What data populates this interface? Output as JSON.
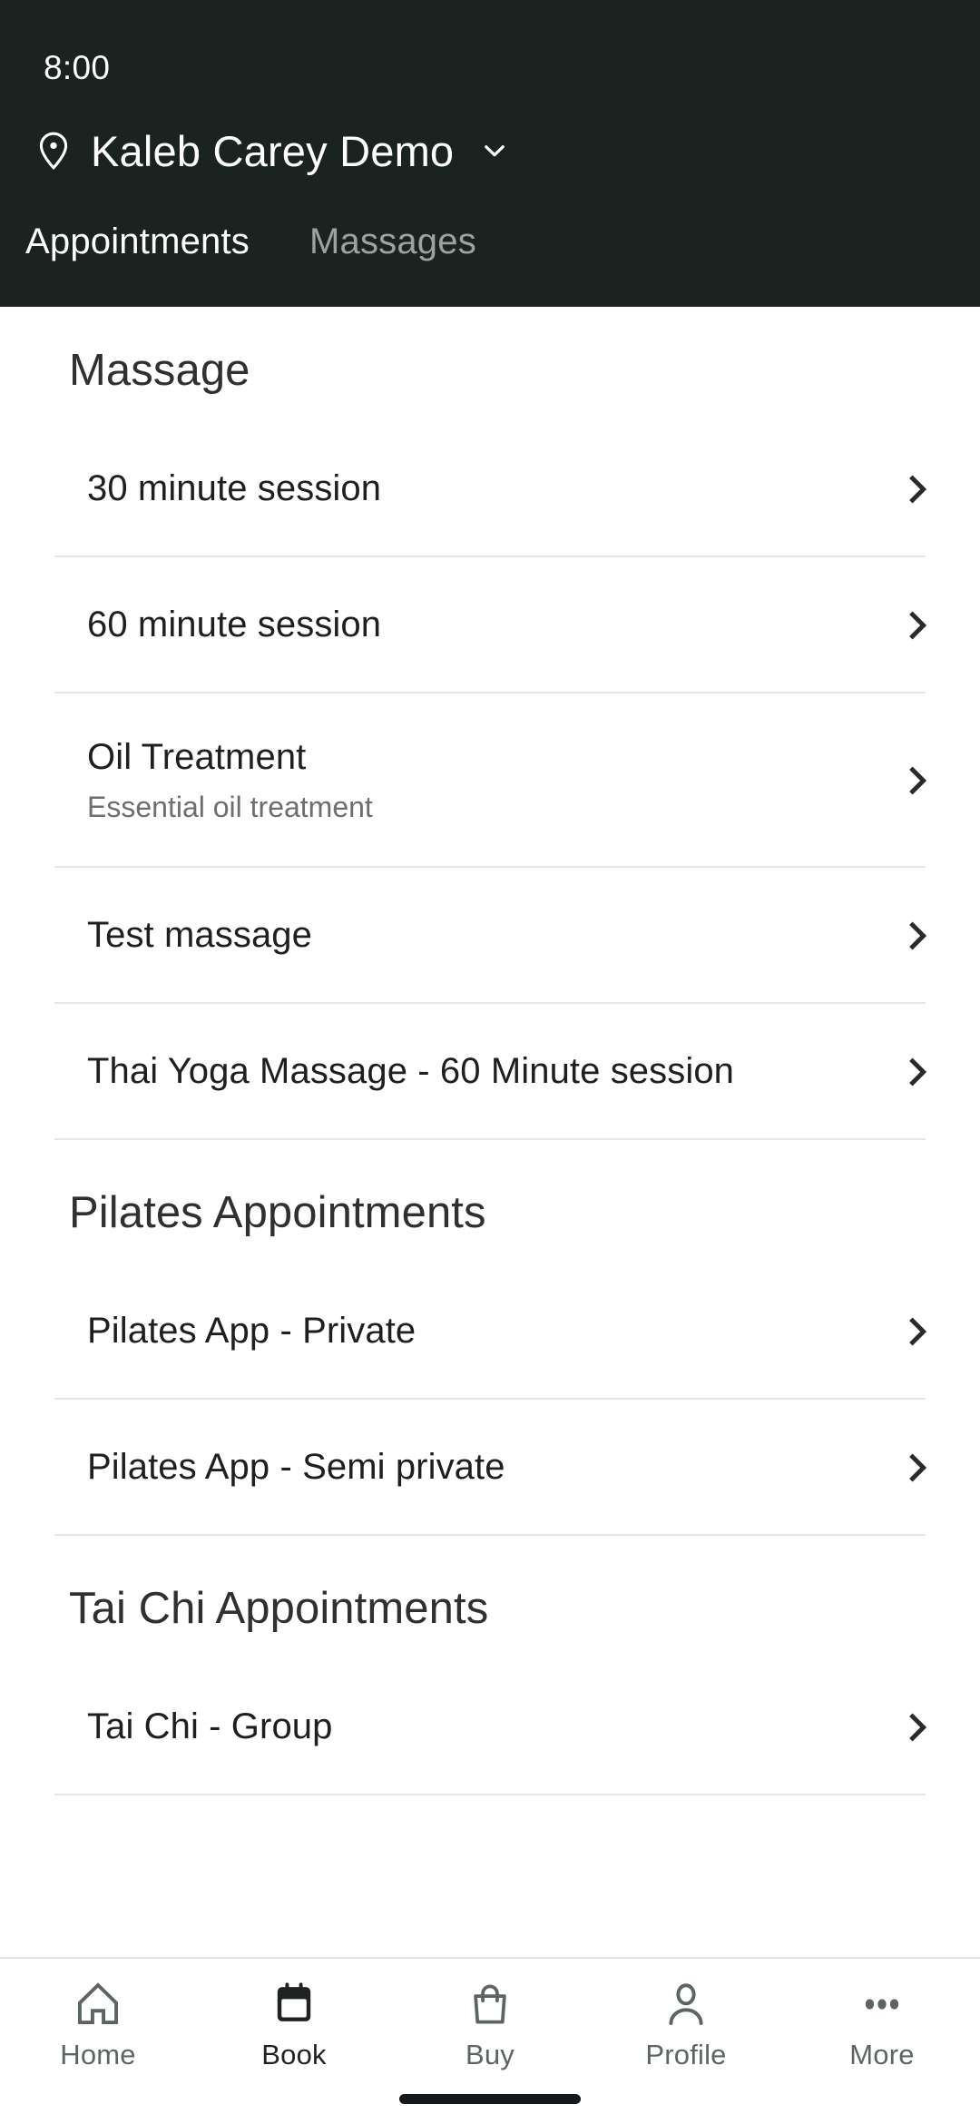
{
  "statusbar": {
    "time": "8:00"
  },
  "header": {
    "location_icon": "map-pin-icon",
    "location_name": "Kaleb Carey Demo",
    "dropdown_icon": "chevron-down-icon",
    "background_color": "#1b2321",
    "tabs": [
      {
        "label": "Appointments",
        "active": true
      },
      {
        "label": "Massages",
        "active": false
      }
    ]
  },
  "content": {
    "sections": [
      {
        "title": "Massage",
        "rows": [
          {
            "title": "30 minute session",
            "subtitle": "",
            "chevron": "chevron-right-icon"
          },
          {
            "title": "60 minute session",
            "subtitle": "",
            "chevron": "chevron-right-icon"
          },
          {
            "title": "Oil Treatment",
            "subtitle": "Essential oil treatment",
            "chevron": "chevron-right-icon"
          },
          {
            "title": "Test massage",
            "subtitle": "",
            "chevron": "chevron-right-icon"
          },
          {
            "title": "Thai Yoga Massage - 60 Minute session",
            "subtitle": "",
            "chevron": "chevron-right-icon"
          }
        ]
      },
      {
        "title": "Pilates Appointments",
        "rows": [
          {
            "title": "Pilates App - Private",
            "subtitle": "",
            "chevron": "chevron-right-icon"
          },
          {
            "title": "Pilates App - Semi private",
            "subtitle": "",
            "chevron": "chevron-right-icon"
          }
        ]
      },
      {
        "title": "Tai Chi Appointments",
        "rows": [
          {
            "title": "Tai Chi - Group",
            "subtitle": "",
            "chevron": "chevron-right-icon"
          }
        ]
      }
    ]
  },
  "bottomnav": {
    "items": [
      {
        "label": "Home",
        "icon": "home-icon",
        "active": false
      },
      {
        "label": "Book",
        "icon": "calendar-icon",
        "active": true
      },
      {
        "label": "Buy",
        "icon": "shopping-bag-icon",
        "active": false
      },
      {
        "label": "Profile",
        "icon": "person-icon",
        "active": false
      },
      {
        "label": "More",
        "icon": "ellipsis-icon",
        "active": false
      }
    ],
    "active_color": "#1f2422",
    "inactive_color": "#5d6563"
  }
}
